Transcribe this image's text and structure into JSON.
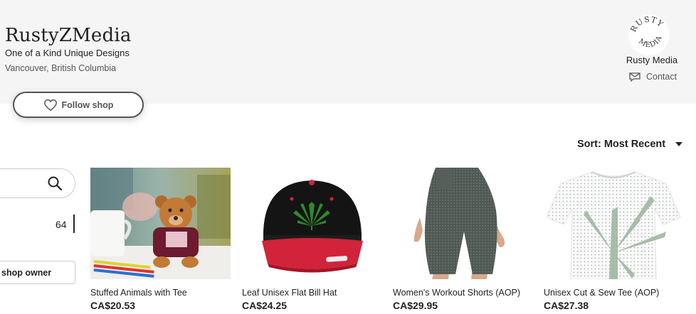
{
  "shop": {
    "name": "RustyZMedia",
    "tagline": "One of a Kind Unique Designs",
    "location": "Vancouver, British Columbia",
    "follow_label": "Follow shop"
  },
  "owner": {
    "logo_text": "RUSTY MEDIA",
    "name": "Rusty Media",
    "contact_label": "Contact"
  },
  "sort": {
    "label": "Sort: Most Recent"
  },
  "sidebar": {
    "count": "64",
    "owner_button": "shop owner"
  },
  "listings": [
    {
      "title": "Stuffed Animals with Tee",
      "price": "CA$20.53",
      "image": "teddy-bear"
    },
    {
      "title": "Leaf Unisex Flat Bill Hat",
      "price": "CA$24.25",
      "image": "black-red-cap"
    },
    {
      "title": "Women's Workout Shorts (AOP)",
      "price": "CA$29.95",
      "image": "workout-shorts"
    },
    {
      "title": "Unisex Cut & Sew Tee (AOP)",
      "price": "CA$27.38",
      "image": "leaf-tee"
    }
  ]
}
